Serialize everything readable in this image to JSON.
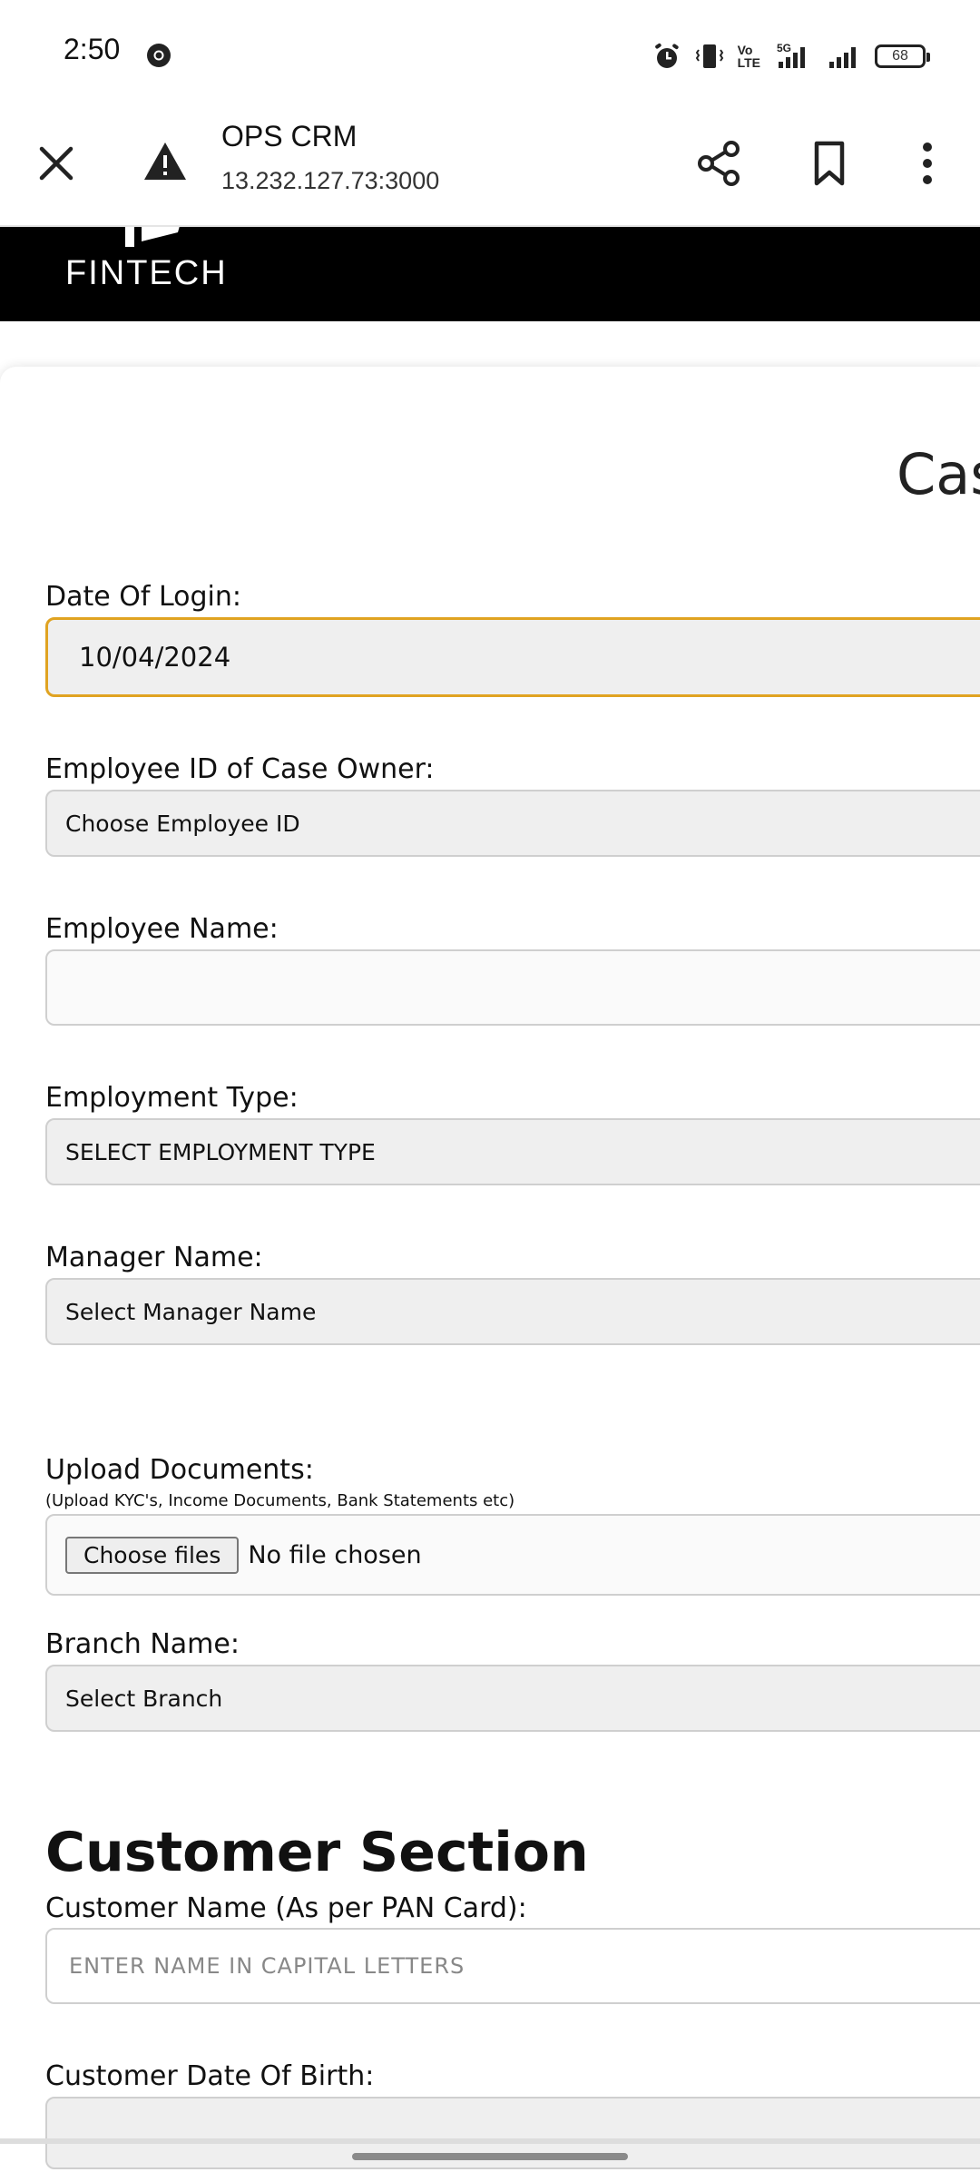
{
  "status_bar": {
    "time": "2:50",
    "network_label": "VoLTE",
    "network_5g": "5G",
    "battery": "68"
  },
  "browser": {
    "page_title": "OPS CRM",
    "url": "13.232.127.73:3000"
  },
  "banner": {
    "logo_text": "FINTECH"
  },
  "form": {
    "heading_partial": "Cas",
    "date_of_login": {
      "label": "Date Of Login:",
      "value": "10/04/2024"
    },
    "employee_id": {
      "label": "Employee ID of Case Owner:",
      "value": "Choose Employee ID"
    },
    "employee_name": {
      "label": "Employee Name:",
      "value": ""
    },
    "employment_type": {
      "label": "Employment Type:",
      "value": "SELECT EMPLOYMENT TYPE"
    },
    "manager_name": {
      "label": "Manager Name:",
      "value": "Select Manager Name"
    },
    "upload": {
      "label": "Upload Documents:",
      "note": "(Upload KYC's, Income Documents, Bank Statements etc)",
      "button": "Choose files",
      "status": "No file chosen"
    },
    "branch_name": {
      "label": "Branch Name:",
      "value": "Select Branch"
    }
  },
  "customer_section": {
    "title": "Customer Section",
    "customer_name": {
      "label": "Customer Name (As per PAN Card):",
      "placeholder": "ENTER NAME IN CAPITAL LETTERS"
    },
    "customer_dob": {
      "label": "Customer Date Of Birth:",
      "value": ""
    }
  },
  "colors": {
    "focus_border": "#e0a321",
    "banner_bg": "#000000"
  }
}
